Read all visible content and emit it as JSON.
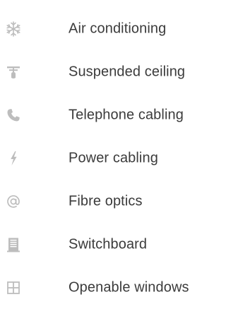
{
  "colors": {
    "icon": "#bdbdbd",
    "text": "#3b3b3b",
    "background": "#ffffff"
  },
  "features": [
    {
      "label": "Air conditioning",
      "icon": "snowflake-icon"
    },
    {
      "label": "Suspended ceiling",
      "icon": "ceiling-lamp-icon"
    },
    {
      "label": "Telephone cabling",
      "icon": "phone-icon"
    },
    {
      "label": "Power cabling",
      "icon": "lightning-icon"
    },
    {
      "label": "Fibre optics",
      "icon": "at-sign-icon"
    },
    {
      "label": "Switchboard",
      "icon": "switchboard-icon"
    },
    {
      "label": "Openable windows",
      "icon": "window-icon"
    }
  ]
}
